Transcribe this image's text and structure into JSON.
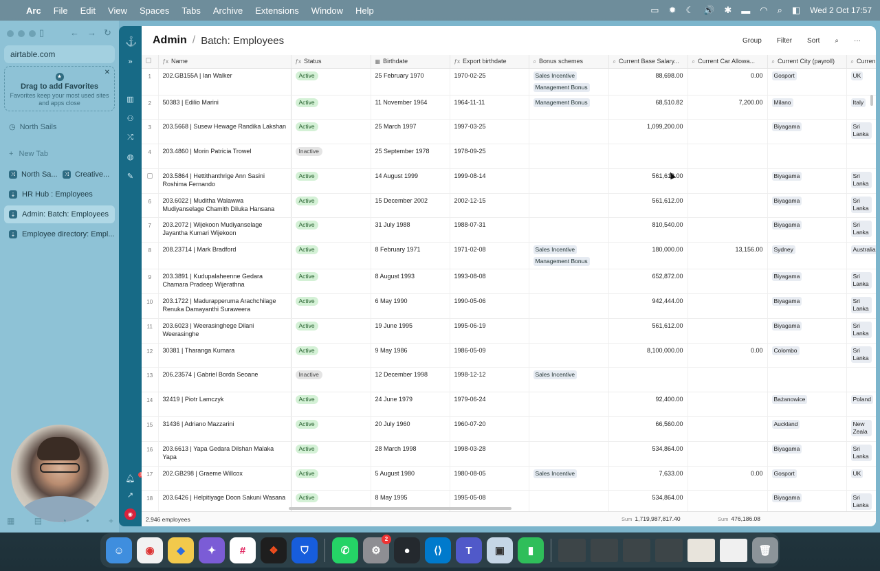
{
  "menubar": {
    "app": "Arc",
    "items": [
      "File",
      "Edit",
      "View",
      "Spaces",
      "Tabs",
      "Archive",
      "Extensions",
      "Window",
      "Help"
    ],
    "datetime": "Wed 2 Oct  17:57"
  },
  "sidebar": {
    "url": "airtable.com",
    "favorites_title": "Drag to add Favorites",
    "favorites_text": "Favorites keep your most used sites and apps close",
    "space_name": "North Sails",
    "new_tab": "New Tab",
    "split_tabs": [
      "North Sa...",
      "Creative..."
    ],
    "tabs": [
      {
        "label": "HR Hub : Employees",
        "active": false
      },
      {
        "label": "Admin: Batch: Employees",
        "active": true
      },
      {
        "label": "Employee directory: Empl...",
        "active": false
      }
    ]
  },
  "rail": {
    "notification_count": "1"
  },
  "header": {
    "title": "Admin",
    "subtitle": "Batch: Employees"
  },
  "toolbar": {
    "group": "Group",
    "filter": "Filter",
    "sort": "Sort"
  },
  "columns": [
    "Name",
    "Status",
    "Birthdate",
    "Export birthdate",
    "Bonus schemes",
    "Current Base Salary...",
    "Current Car Allowa...",
    "Current City (payroll)",
    "Curren"
  ],
  "rows": [
    {
      "n": "1",
      "name": "202.GB155A | Ian Walker",
      "status": "Active",
      "birth": "25 February 1970",
      "export": "1970-02-25",
      "bonus": [
        "Sales Incentive",
        "Management Bonus"
      ],
      "salary": "88,698.00",
      "car": "0.00",
      "city": "Gosport",
      "country": "UK"
    },
    {
      "n": "2",
      "name": "50383 | Edilio Marini",
      "status": "Active",
      "birth": "11 November 1964",
      "export": "1964-11-11",
      "bonus": [
        "Management Bonus"
      ],
      "salary": "68,510.82",
      "car": "7,200.00",
      "city": "Milano",
      "country": "Italy"
    },
    {
      "n": "3",
      "name": "203.5668 | Susew Hewage Randika Lakshan",
      "status": "Active",
      "birth": "25 March 1997",
      "export": "1997-03-25",
      "bonus": [],
      "salary": "1,099,200.00",
      "car": "",
      "city": "Biyagama",
      "country": "Sri Lanka"
    },
    {
      "n": "4",
      "name": "203.4860 | Morin  Patricia Trowel",
      "status": "Inactive",
      "birth": "25 September 1978",
      "export": "1978-09-25",
      "bonus": [],
      "salary": "",
      "car": "",
      "city": "",
      "country": ""
    },
    {
      "n": "",
      "name": "203.5864 | Hettithanthrige Ann Sasini Roshima Fernando",
      "status": "Active",
      "birth": "14 August 1999",
      "export": "1999-08-14",
      "bonus": [],
      "salary": "561,612.00",
      "car": "",
      "city": "Biyagama",
      "country": "Sri Lanka"
    },
    {
      "n": "6",
      "name": "203.6022 | Muditha Walawwa Mudiyanselage Chamith Diluka Hansana",
      "status": "Active",
      "birth": "15 December 2002",
      "export": "2002-12-15",
      "bonus": [],
      "salary": "561,612.00",
      "car": "",
      "city": "Biyagama",
      "country": "Sri Lanka"
    },
    {
      "n": "7",
      "name": "203.2072 | Wijekoon Mudiyanselage Jayantha Kumari Wijekoon",
      "status": "Active",
      "birth": "31 July 1988",
      "export": "1988-07-31",
      "bonus": [],
      "salary": "810,540.00",
      "car": "",
      "city": "Biyagama",
      "country": "Sri Lanka"
    },
    {
      "n": "8",
      "name": "208.23714 | Mark Bradford",
      "status": "Active",
      "birth": "8 February 1971",
      "export": "1971-02-08",
      "bonus": [
        "Sales Incentive",
        "Management Bonus"
      ],
      "salary": "180,000.00",
      "car": "13,156.00",
      "city": "Sydney",
      "country": "Australia"
    },
    {
      "n": "9",
      "name": "203.3891 | Kudupalaheenne Gedara Chamara Pradeep Wijerathna",
      "status": "Active",
      "birth": "8 August 1993",
      "export": "1993-08-08",
      "bonus": [],
      "salary": "652,872.00",
      "car": "",
      "city": "Biyagama",
      "country": "Sri Lanka"
    },
    {
      "n": "10",
      "name": "203.1722 | Madurapperuma Arachchilage Renuka Damayanthi Suraweera",
      "status": "Active",
      "birth": "6 May 1990",
      "export": "1990-05-06",
      "bonus": [],
      "salary": "942,444.00",
      "car": "",
      "city": "Biyagama",
      "country": "Sri Lanka"
    },
    {
      "n": "11",
      "name": "203.6023 | Weerasinghege Dilani Weerasinghe",
      "status": "Active",
      "birth": "19 June 1995",
      "export": "1995-06-19",
      "bonus": [],
      "salary": "561,612.00",
      "car": "",
      "city": "Biyagama",
      "country": "Sri Lanka"
    },
    {
      "n": "12",
      "name": "30381 | Tharanga Kumara",
      "status": "Active",
      "birth": "9 May 1986",
      "export": "1986-05-09",
      "bonus": [],
      "salary": "8,100,000.00",
      "car": "0.00",
      "city": "Colombo",
      "country": "Sri Lanka"
    },
    {
      "n": "13",
      "name": "206.23574 | Gabriel Borda Seoane",
      "status": "Inactive",
      "birth": "12 December 1998",
      "export": "1998-12-12",
      "bonus": [
        "Sales Incentive"
      ],
      "salary": "",
      "car": "",
      "city": "",
      "country": ""
    },
    {
      "n": "14",
      "name": "32419 | Piotr Lamczyk",
      "status": "Active",
      "birth": "24 June 1979",
      "export": "1979-06-24",
      "bonus": [],
      "salary": "92,400.00",
      "car": "",
      "city": "Bażanowice",
      "country": "Poland"
    },
    {
      "n": "15",
      "name": "31436 | Adriano Mazzarini",
      "status": "Active",
      "birth": "20 July 1960",
      "export": "1960-07-20",
      "bonus": [],
      "salary": "66,560.00",
      "car": "",
      "city": "Auckland",
      "country": "New Zeala"
    },
    {
      "n": "16",
      "name": "203.6613 | Yapa Gedara Dilshan Malaka Yapa",
      "status": "Active",
      "birth": "28 March 1998",
      "export": "1998-03-28",
      "bonus": [],
      "salary": "534,864.00",
      "car": "",
      "city": "Biyagama",
      "country": "Sri Lanka"
    },
    {
      "n": "17",
      "name": "202.GB298 | Graeme Willcox",
      "status": "Active",
      "birth": "5 August 1980",
      "export": "1980-08-05",
      "bonus": [
        "Sales Incentive"
      ],
      "salary": "7,633.00",
      "car": "0.00",
      "city": "Gosport",
      "country": "UK"
    },
    {
      "n": "18",
      "name": "203.6426 | Helpitiyage Doon  Sakuni Wasana",
      "status": "Active",
      "birth": "8 May 1995",
      "export": "1995-05-08",
      "bonus": [],
      "salary": "534,864.00",
      "car": "",
      "city": "Biyagama",
      "country": "Sri Lanka"
    }
  ],
  "footer": {
    "count": "2,946 employees",
    "sum_label": "Sum",
    "sum_salary": "1,719,987,817.40",
    "sum_car": "476,186.08"
  },
  "dock": {
    "system_settings_badge": "2"
  }
}
